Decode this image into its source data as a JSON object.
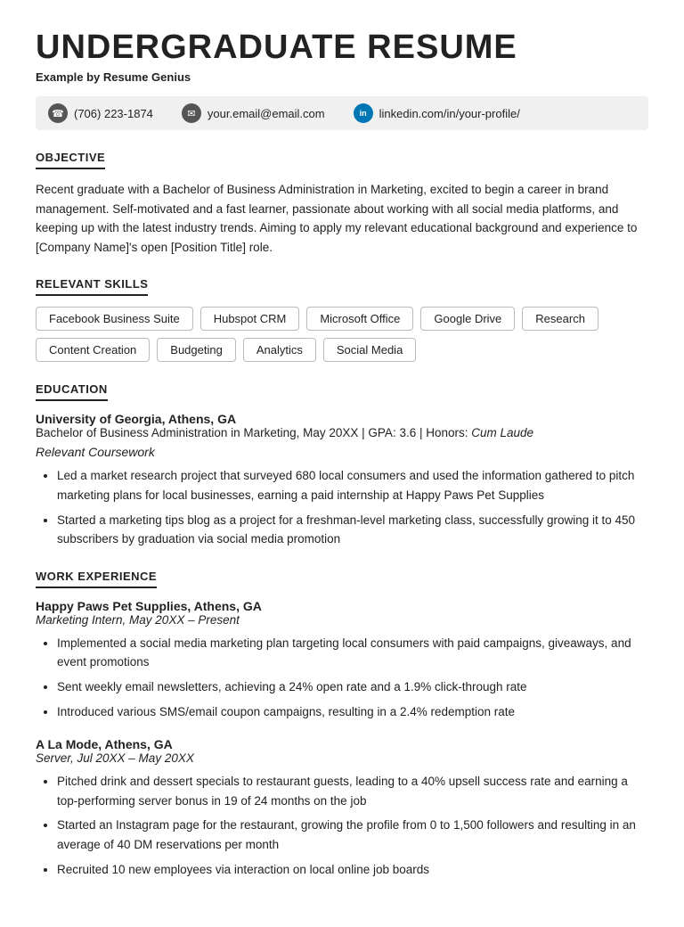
{
  "resume": {
    "title": "Undergraduate Resume",
    "subtitle": "Example by Resume Genius",
    "contact": {
      "phone": "(706) 223-1874",
      "email": "your.email@email.com",
      "linkedin": "linkedin.com/in/your-profile/"
    },
    "objective": {
      "heading": "Objective",
      "text": "Recent graduate with a Bachelor of Business Administration in Marketing, excited to begin a career in brand management. Self-motivated and a fast learner, passionate about working with all social media platforms, and keeping up with the latest industry trends. Aiming to apply my relevant educational background and experience to [Company Name]'s open [Position Title] role."
    },
    "skills": {
      "heading": "Relevant Skills",
      "items": [
        "Facebook Business Suite",
        "Hubspot CRM",
        "Microsoft Office",
        "Google Drive",
        "Research",
        "Content Creation",
        "Budgeting",
        "Analytics",
        "Social Media"
      ]
    },
    "education": {
      "heading": "Education",
      "entries": [
        {
          "school": "University of Georgia, Athens, GA",
          "degree": "Bachelor of Business Administration in Marketing, May 20XX | GPA: 3.6 | Honors: Cum Laude",
          "coursework_label": "Relevant Coursework",
          "bullets": [
            "Led a market research project that surveyed 680 local consumers and used the information gathered to pitch marketing plans for local businesses, earning a paid internship at Happy Paws Pet Supplies",
            "Started a marketing tips blog as a project for a freshman-level marketing class, successfully growing it to 450 subscribers by graduation via social media promotion"
          ]
        }
      ]
    },
    "work_experience": {
      "heading": "Work Experience",
      "entries": [
        {
          "company": "Happy Paws Pet Supplies, Athens, GA",
          "title": "Marketing Intern, May 20XX – Present",
          "bullets": [
            "Implemented a social media marketing plan targeting local consumers with paid campaigns, giveaways, and event promotions",
            "Sent weekly email newsletters, achieving a 24% open rate and a 1.9% click-through rate",
            "Introduced various SMS/email coupon campaigns, resulting in a 2.4% redemption rate"
          ]
        },
        {
          "company": "A La Mode, Athens, GA",
          "title": "Server, Jul 20XX – May 20XX",
          "bullets": [
            "Pitched drink and dessert specials to restaurant guests, leading to a 40% upsell success rate and earning a top-performing server bonus in 19 of 24 months on the job",
            "Started an Instagram page for the restaurant, growing the profile from 0 to 1,500 followers and resulting in an average of 40 DM reservations per month",
            "Recruited 10 new employees via interaction on local online job boards"
          ]
        }
      ]
    }
  }
}
